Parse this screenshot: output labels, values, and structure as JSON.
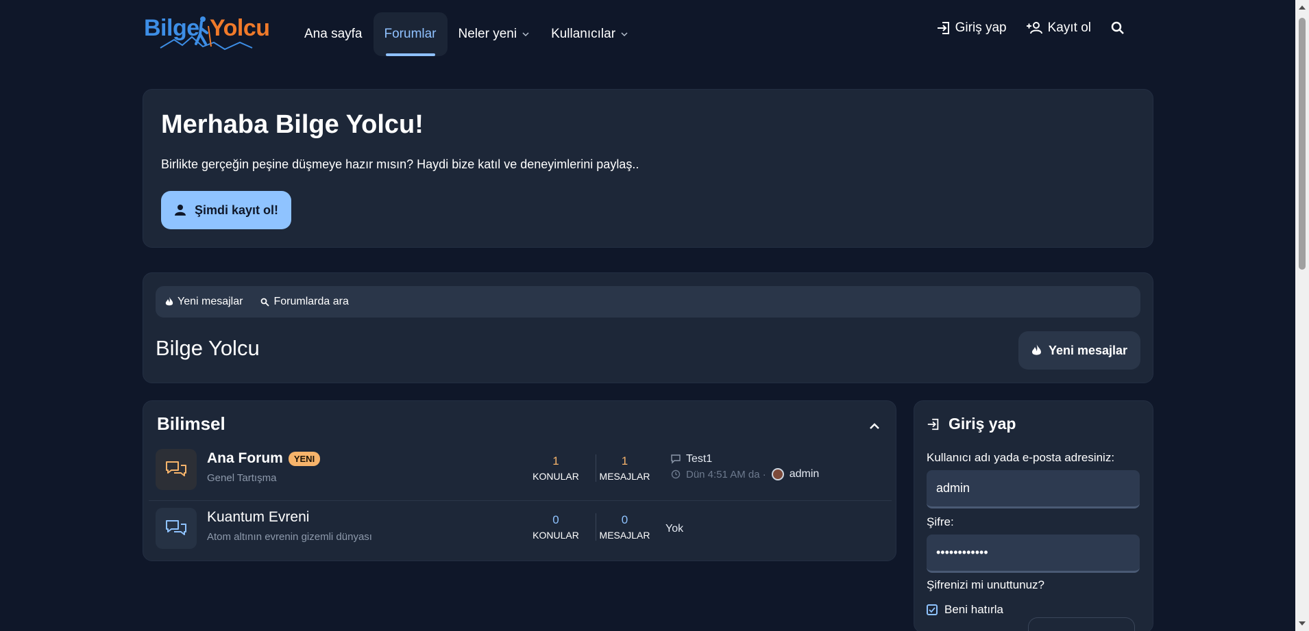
{
  "brand": {
    "word1": "Bilge",
    "word2": "Yolcu",
    "color1": "#3d8ee6",
    "color2": "#f07a2a"
  },
  "nav": {
    "items": [
      {
        "label": "Ana sayfa"
      },
      {
        "label": "Forumlar",
        "active": true
      },
      {
        "label": "Neler yeni",
        "dropdown": true
      },
      {
        "label": "Kullanıcılar",
        "dropdown": true
      }
    ]
  },
  "user_nav": {
    "login": "Giriş yap",
    "register": "Kayıt ol",
    "search_icon": "search-icon"
  },
  "hero": {
    "title": "Merhaba Bilge Yolcu!",
    "text": "Birlikte gerçeğin peşine düşmeye hazır mısın? Haydi bize katıl ve deneyimlerini paylaş..",
    "button": "Şimdi kayıt ol!"
  },
  "actions": {
    "new_messages": "Yeni mesajlar",
    "search_forums": "Forumlarda ara",
    "forum_title": "Bilge Yolcu",
    "new_messages_button": "Yeni mesajlar"
  },
  "category": {
    "title": "Bilimsel",
    "nodes": [
      {
        "title": "Ana Forum",
        "badge": "YENI",
        "description": "Genel Tartışma",
        "threads": "1",
        "messages": "1",
        "threads_label": "KONULAR",
        "messages_label": "MESAJLAR",
        "latest_title": "Test1",
        "latest_time": "Dün 4:51 AM da ·",
        "latest_user": "admin"
      },
      {
        "title": "Kuantum Evreni",
        "description": "Atom altının evrenin gizemli dünyası",
        "threads": "0",
        "messages": "0",
        "threads_label": "KONULAR",
        "messages_label": "MESAJLAR",
        "latest_none": "Yok"
      }
    ]
  },
  "login": {
    "title": "Giriş yap",
    "username_label": "Kullanıcı adı yada e-posta adresiniz:",
    "username_value": "admin",
    "password_label": "Şifre:",
    "password_value": "••••••••••••",
    "forgot": "Şifrenizi mi unuttunuz?",
    "remember": "Beni hatırla"
  },
  "colors": {
    "background": "#0f1729",
    "card": "#1d2738",
    "accent": "#8fc3ff",
    "badge": "#f7b46b"
  }
}
